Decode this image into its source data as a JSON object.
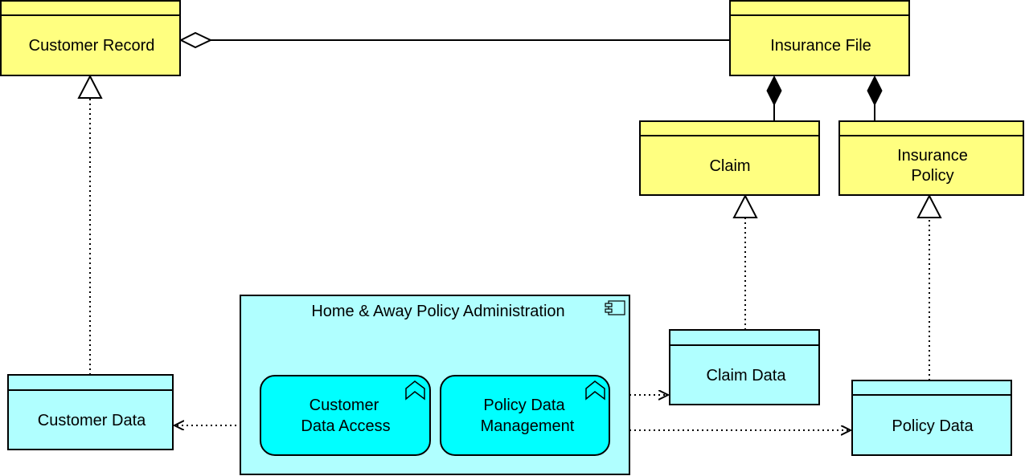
{
  "colors": {
    "business_object": "#ffff80",
    "data_object": "#b0ffff",
    "application_component": "#b0ffff",
    "application_function": "#00ffff",
    "line": "#000000"
  },
  "business_objects": {
    "customer_record": "Customer Record",
    "insurance_file": "Insurance File",
    "claim": "Claim",
    "insurance_policy": [
      "Insurance",
      "Policy"
    ]
  },
  "data_objects": {
    "customer_data": "Customer Data",
    "claim_data": "Claim Data",
    "policy_data": "Policy Data"
  },
  "application_component": {
    "name": "Home & Away Policy Administration",
    "icon": "component-icon",
    "functions": [
      {
        "lines": [
          "Customer",
          "Data Access"
        ],
        "icon": "function-chevron-icon"
      },
      {
        "lines": [
          "Policy Data",
          "Management"
        ],
        "icon": "function-chevron-icon"
      }
    ]
  },
  "relationships": [
    {
      "type": "aggregation",
      "from": "Customer Record",
      "to": "Insurance File"
    },
    {
      "type": "composition",
      "from": "Insurance File",
      "to": "Claim"
    },
    {
      "type": "composition",
      "from": "Insurance File",
      "to": "Insurance Policy"
    },
    {
      "type": "realization",
      "from": "Customer Data",
      "to": "Customer Record"
    },
    {
      "type": "realization",
      "from": "Claim Data",
      "to": "Claim"
    },
    {
      "type": "realization",
      "from": "Policy Data",
      "to": "Insurance Policy"
    },
    {
      "type": "access",
      "from": "Customer Data Access",
      "to": "Customer Data"
    },
    {
      "type": "access",
      "from": "Policy Data Management",
      "to": "Claim Data"
    },
    {
      "type": "access",
      "from": "Policy Data Management",
      "to": "Policy Data"
    }
  ]
}
